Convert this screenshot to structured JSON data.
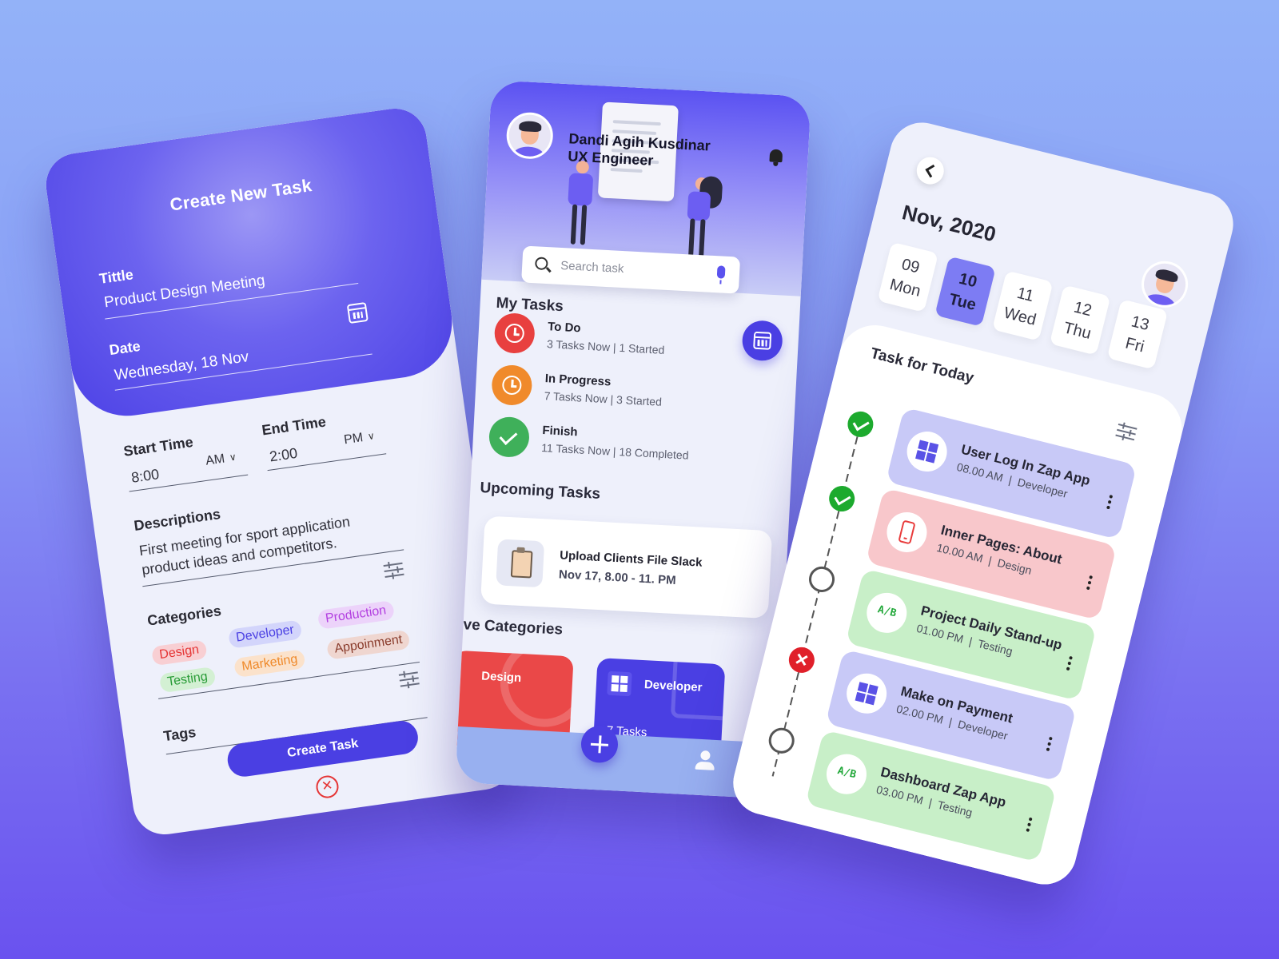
{
  "colors": {
    "primary": "#4a3fe3",
    "red": "#e53535",
    "orange": "#f08a2b",
    "green": "#3fb05a",
    "lavender_card": "#c9cbfa",
    "pink_card": "#f8c9cc",
    "green_card": "#c9f1c9"
  },
  "create_task": {
    "title": "Create New Task",
    "title_label": "Tittle",
    "title_value": "Product Design Meeting",
    "date_label": "Date",
    "date_value": "Wednesday, 18 Nov",
    "calendar_icon": "calendar-icon",
    "start_time_label": "Start Time",
    "start_time_value": "8:00",
    "start_ampm": "AM",
    "end_time_label": "End Time",
    "end_time_value": "2:00",
    "end_ampm": "PM",
    "descriptions_label": "Descriptions",
    "descriptions_line1": "First meeting for sport application",
    "descriptions_line2": "product ideas and competitors.",
    "categories_label": "Categories",
    "categories": [
      {
        "label": "Design",
        "color": "#e53535",
        "bg": "#f8cfd3"
      },
      {
        "label": "Developer",
        "color": "#4a3fe3",
        "bg": "#d3d5fb"
      },
      {
        "label": "Production",
        "color": "#b23ee0",
        "bg": "#ecd3fa"
      },
      {
        "label": "Testing",
        "color": "#2a9c38",
        "bg": "#d3f0d3"
      },
      {
        "label": "Marketing",
        "color": "#ef8a2b",
        "bg": "#fbe2cb"
      },
      {
        "label": "Appoinment",
        "color": "#8a3c2c",
        "bg": "#efd6d0"
      }
    ],
    "tags_label": "Tags",
    "create_button": "Create Task"
  },
  "home": {
    "user_name": "Dandi Agih Kusdinar",
    "user_role": "UX Engineer",
    "search_placeholder": "Search task",
    "my_tasks_title": "My Tasks",
    "tasks": [
      {
        "name": "To Do",
        "meta": "3 Tasks Now  |  1 Started",
        "icon": "clock-icon",
        "color": "#e8403f"
      },
      {
        "name": "In Progress",
        "meta": "7 Tasks Now  |  3 Started",
        "icon": "progress-clock-icon",
        "color": "#f08a2b"
      },
      {
        "name": "Finish",
        "meta": "11 Tasks Now  |  18 Completed",
        "icon": "check-icon",
        "color": "#3fb05a"
      }
    ],
    "upcoming_title": "Upcoming Tasks",
    "upcoming": {
      "title": "Upload Clients File Slack",
      "date": "Nov 17, 8.00 - 11. PM"
    },
    "categories_title": "ve Categories",
    "categories": [
      {
        "name": "Design",
        "color": "#ea4848"
      },
      {
        "name": "Developer",
        "count": "7 Tasks",
        "color": "#4a3fe3"
      }
    ]
  },
  "calendar": {
    "month": "Nov, 2020",
    "days": [
      {
        "num": "09",
        "name": "Mon",
        "active": false
      },
      {
        "num": "10",
        "name": "Tue",
        "active": true
      },
      {
        "num": "11",
        "name": "Wed",
        "active": false
      },
      {
        "num": "12",
        "name": "Thu",
        "active": false
      },
      {
        "num": "13",
        "name": "Fri",
        "active": false
      }
    ],
    "today_title": "Task for Today",
    "tasks": [
      {
        "title": "User Log In Zap App",
        "time": "08.00 AM",
        "category": "Developer",
        "status": "done",
        "icon": "windows-icon",
        "bg": "#c8c9f7"
      },
      {
        "title": "Inner Pages: About",
        "time": "10.00 AM",
        "category": "Design",
        "status": "done",
        "icon": "smartphone-icon",
        "bg": "#f8c7cb"
      },
      {
        "title": "Project Daily Stand-up",
        "time": "01.00 PM",
        "category": "Testing",
        "status": "pending",
        "icon": "ab-test-icon",
        "bg": "#c8efc8"
      },
      {
        "title": "Make on Payment",
        "time": "02.00 PM",
        "category": "Developer",
        "status": "failed",
        "icon": "windows-icon",
        "bg": "#c8c9f7"
      },
      {
        "title": "Dashboard Zap App",
        "time": "03.00 PM",
        "category": "Testing",
        "status": "pending",
        "icon": "ab-test-icon",
        "bg": "#c8efc8"
      }
    ]
  }
}
